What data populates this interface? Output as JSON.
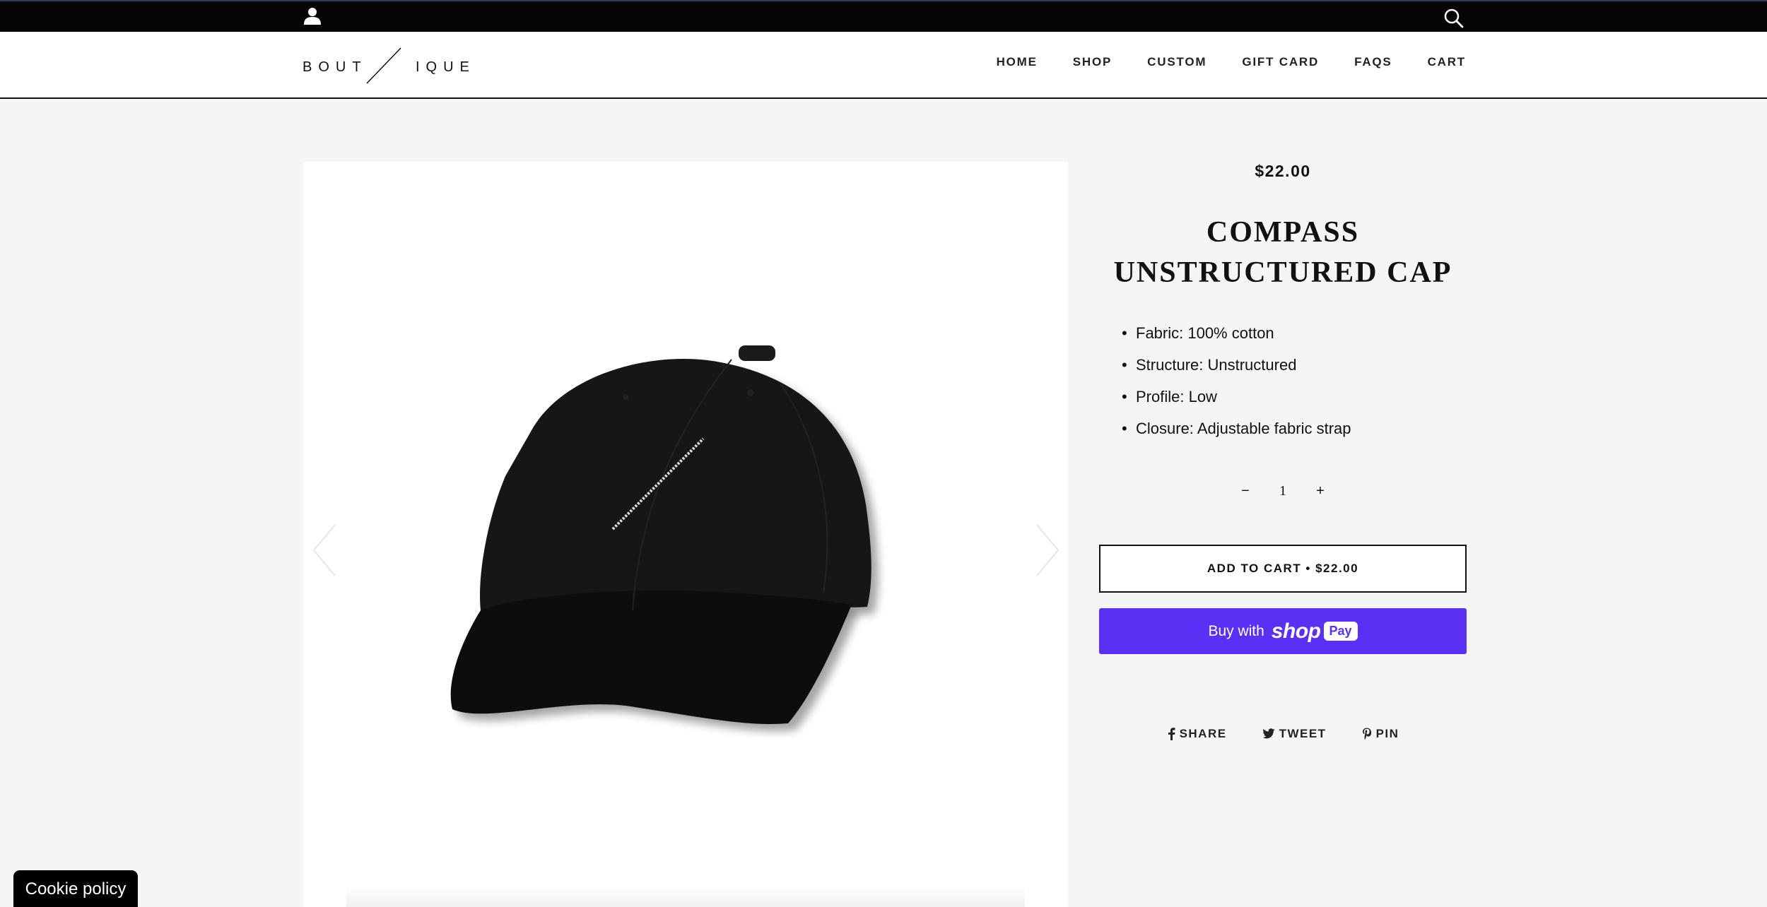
{
  "topbar": {
    "account_icon": "user-icon",
    "search_icon": "search-icon"
  },
  "header": {
    "logo": {
      "left": "BOUT",
      "right": "IQUE"
    },
    "nav": [
      "HOME",
      "SHOP",
      "CUSTOM",
      "GIFT CARD",
      "FAQS",
      "CART"
    ]
  },
  "gallery": {
    "prev_icon": "chevron-left-icon",
    "next_icon": "chevron-right-icon",
    "image": "black-cap-image"
  },
  "product": {
    "price": "$22.00",
    "title_line1": "COMPASS",
    "title_line2": "UNSTRUCTURED CAP",
    "specs": [
      "Fabric: 100% cotton",
      "Structure: Unstructured",
      "Profile: Low",
      "Closure: Adjustable fabric strap"
    ],
    "quantity": {
      "minus": "−",
      "value": "1",
      "plus": "+"
    },
    "add_to_cart": "ADD TO CART • $22.00",
    "shop_pay": {
      "buy_with": "Buy with",
      "shop": "shop",
      "pay": "Pay"
    },
    "share": {
      "share": "SHARE",
      "tweet": "TWEET",
      "pin": "PIN"
    }
  },
  "colors": {
    "topbar": "#050507",
    "shop_pay": "#5a31f4",
    "page_bg": "#f5f5f5"
  },
  "cookie": {
    "label": "Cookie policy"
  }
}
